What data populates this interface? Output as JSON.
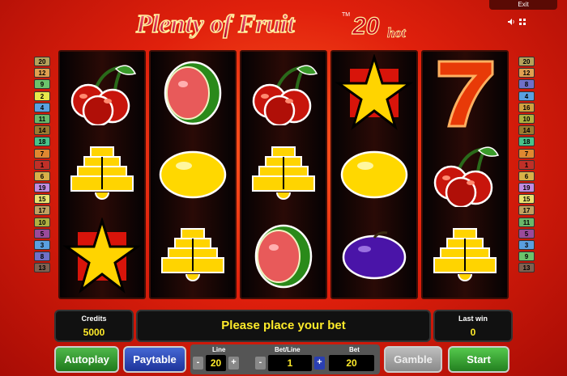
{
  "header": {
    "title_main": "Plenty of Fruit",
    "title_tm": "TM",
    "title_number": "20",
    "title_suffix": "hot",
    "exit_label": "Exit"
  },
  "paylines": {
    "left": [
      {
        "n": "20",
        "color": "#b5a15a"
      },
      {
        "n": "12",
        "color": "#e0a050"
      },
      {
        "n": "9",
        "color": "#6cc36c"
      },
      {
        "n": "2",
        "color": "#e8e84a"
      },
      {
        "n": "4",
        "color": "#5aa0e0"
      },
      {
        "n": "11",
        "color": "#6ab86a"
      },
      {
        "n": "14",
        "color": "#9a7a30"
      },
      {
        "n": "18",
        "color": "#48c28a"
      },
      {
        "n": "7",
        "color": "#e08830"
      },
      {
        "n": "1",
        "color": "#c03028"
      },
      {
        "n": "6",
        "color": "#d8b048"
      },
      {
        "n": "19",
        "color": "#c08ae0"
      },
      {
        "n": "15",
        "color": "#e8e070"
      },
      {
        "n": "17",
        "color": "#c0a060"
      },
      {
        "n": "10",
        "color": "#b0b040"
      },
      {
        "n": "5",
        "color": "#9a4a9a"
      },
      {
        "n": "3",
        "color": "#5aa0e0"
      },
      {
        "n": "8",
        "color": "#7070c8"
      },
      {
        "n": "13",
        "color": "#806050"
      }
    ],
    "right": [
      {
        "n": "20",
        "color": "#b5a15a"
      },
      {
        "n": "12",
        "color": "#e0a050"
      },
      {
        "n": "8",
        "color": "#7070c8"
      },
      {
        "n": "4",
        "color": "#5aa0e0"
      },
      {
        "n": "16",
        "color": "#d0a040"
      },
      {
        "n": "10",
        "color": "#b0b040"
      },
      {
        "n": "14",
        "color": "#9a7a30"
      },
      {
        "n": "18",
        "color": "#48c28a"
      },
      {
        "n": "7",
        "color": "#e08830"
      },
      {
        "n": "1",
        "color": "#c03028"
      },
      {
        "n": "6",
        "color": "#d8b048"
      },
      {
        "n": "19",
        "color": "#c08ae0"
      },
      {
        "n": "15",
        "color": "#e8e070"
      },
      {
        "n": "17",
        "color": "#c0a060"
      },
      {
        "n": "11",
        "color": "#6ab86a"
      },
      {
        "n": "5",
        "color": "#9a4a9a"
      },
      {
        "n": "3",
        "color": "#5aa0e0"
      },
      {
        "n": "9",
        "color": "#6cc36c"
      },
      {
        "n": "13",
        "color": "#806050"
      }
    ]
  },
  "reels": [
    [
      "cherries",
      "bell",
      "star"
    ],
    [
      "watermelon",
      "lemon",
      "bell"
    ],
    [
      "cherries",
      "bell",
      "watermelon"
    ],
    [
      "star",
      "lemon",
      "plum"
    ],
    [
      "seven",
      "cherries",
      "bell"
    ]
  ],
  "credits": {
    "label": "Credits",
    "value": "5000"
  },
  "message": "Please place your bet",
  "last_win": {
    "label": "Last win",
    "value": "0"
  },
  "buttons": {
    "autoplay": "Autoplay",
    "paytable": "Paytable",
    "gamble": "Gamble",
    "start": "Start"
  },
  "bet_panel": {
    "line_label": "Line",
    "line_value": "20",
    "bet_line_label": "Bet/Line",
    "bet_line_value": "1",
    "bet_label": "Bet",
    "bet_value": "20",
    "minus": "-",
    "plus": "+"
  }
}
